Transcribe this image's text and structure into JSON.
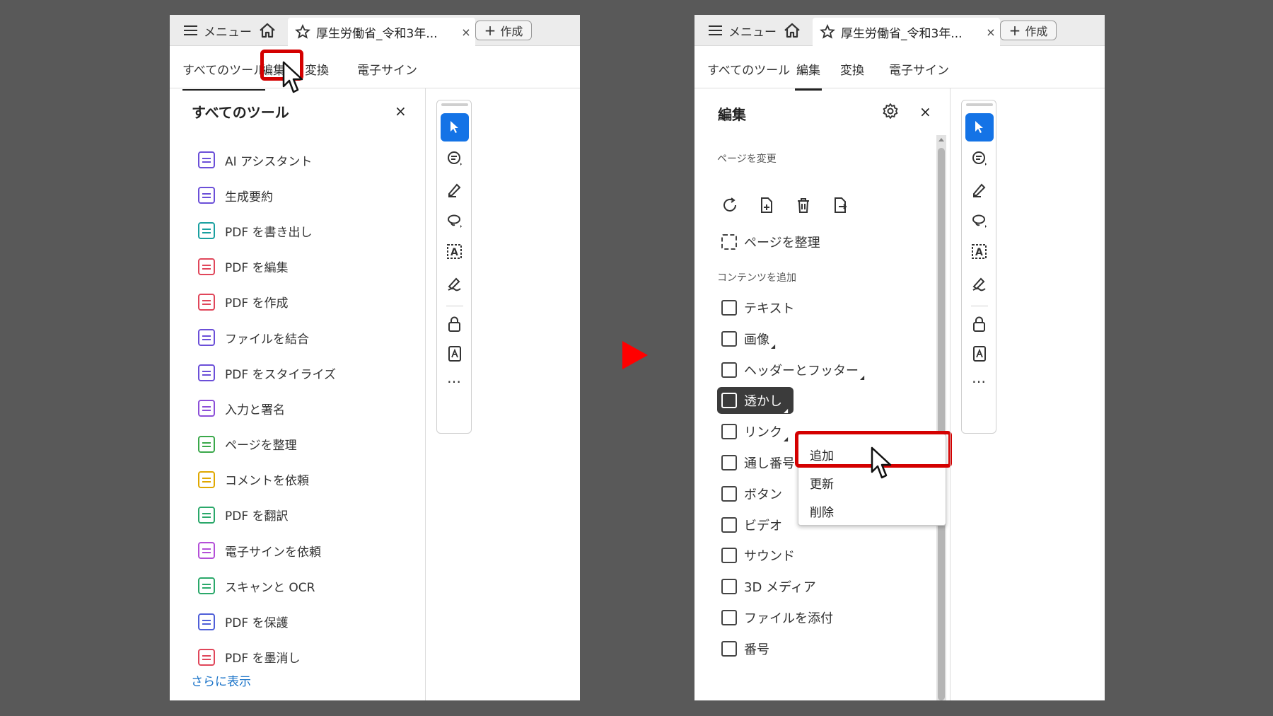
{
  "tabbar": {
    "menu_label": "メニュー",
    "doc_title": "厚生労働省_令和3年...",
    "close_glyph": "×",
    "create_label": "作成",
    "create_plus": "+"
  },
  "tool_tabs": [
    "すべてのツール",
    "編集",
    "変換",
    "電子サイン"
  ],
  "left_panel": {
    "title": "すべてのツール",
    "close_glyph": "×",
    "tools": [
      {
        "label": "AI アシスタント",
        "color": "#6b4fd8",
        "icon": "ai-assistant-icon"
      },
      {
        "label": "生成要約",
        "color": "#6b4fd8",
        "icon": "summary-icon"
      },
      {
        "label": "PDF を書き出し",
        "color": "#1aa0a0",
        "icon": "export-pdf-icon"
      },
      {
        "label": "PDF を編集",
        "color": "#e0465a",
        "icon": "edit-pdf-icon"
      },
      {
        "label": "PDF を作成",
        "color": "#e0465a",
        "icon": "create-pdf-icon"
      },
      {
        "label": "ファイルを結合",
        "color": "#6b4fd8",
        "icon": "combine-icon"
      },
      {
        "label": "PDF をスタイライズ",
        "color": "#6b4fd8",
        "icon": "stylize-icon"
      },
      {
        "label": "入力と署名",
        "color": "#8c4fd8",
        "icon": "fill-sign-icon"
      },
      {
        "label": "ページを整理",
        "color": "#3aa84a",
        "icon": "organize-icon"
      },
      {
        "label": "コメントを依頼",
        "color": "#e0a800",
        "icon": "comment-request-icon"
      },
      {
        "label": "PDF を翻訳",
        "color": "#2aa86a",
        "icon": "translate-icon"
      },
      {
        "label": "電子サインを依頼",
        "color": "#b44fd8",
        "icon": "request-sign-icon"
      },
      {
        "label": "スキャンと OCR",
        "color": "#2aa86a",
        "icon": "scan-ocr-icon"
      },
      {
        "label": "PDF を保護",
        "color": "#4f5fd8",
        "icon": "protect-icon"
      },
      {
        "label": "PDF を墨消し",
        "color": "#e0465a",
        "icon": "redact-icon"
      }
    ],
    "more_link": "さらに表示"
  },
  "right_panel": {
    "title": "編集",
    "close_glyph": "×",
    "section_pages": "ページを変更",
    "organize_label": "ページを整理",
    "section_content": "コンテンツを追加",
    "items": [
      {
        "label": "テキスト",
        "submenu": false
      },
      {
        "label": "画像",
        "submenu": true
      },
      {
        "label": "ヘッダーとフッター",
        "submenu": true
      },
      {
        "label": "透かし",
        "submenu": true,
        "selected": true
      },
      {
        "label": "リンク",
        "submenu": true
      },
      {
        "label": "通し番号",
        "submenu": false
      },
      {
        "label": "ボタン",
        "submenu": false
      },
      {
        "label": "ビデオ",
        "submenu": false
      },
      {
        "label": "サウンド",
        "submenu": false
      },
      {
        "label": "3D メディア",
        "submenu": false
      },
      {
        "label": "ファイルを添付",
        "submenu": false
      },
      {
        "label": "番号",
        "submenu": false
      }
    ],
    "popup": [
      "追加",
      "更新",
      "削除"
    ]
  },
  "toolbar": {
    "more": "…",
    "accent": "#1473e6"
  },
  "colors": {
    "highlight": "#d40000",
    "arrow": "#ff0000",
    "background": "#595959"
  }
}
